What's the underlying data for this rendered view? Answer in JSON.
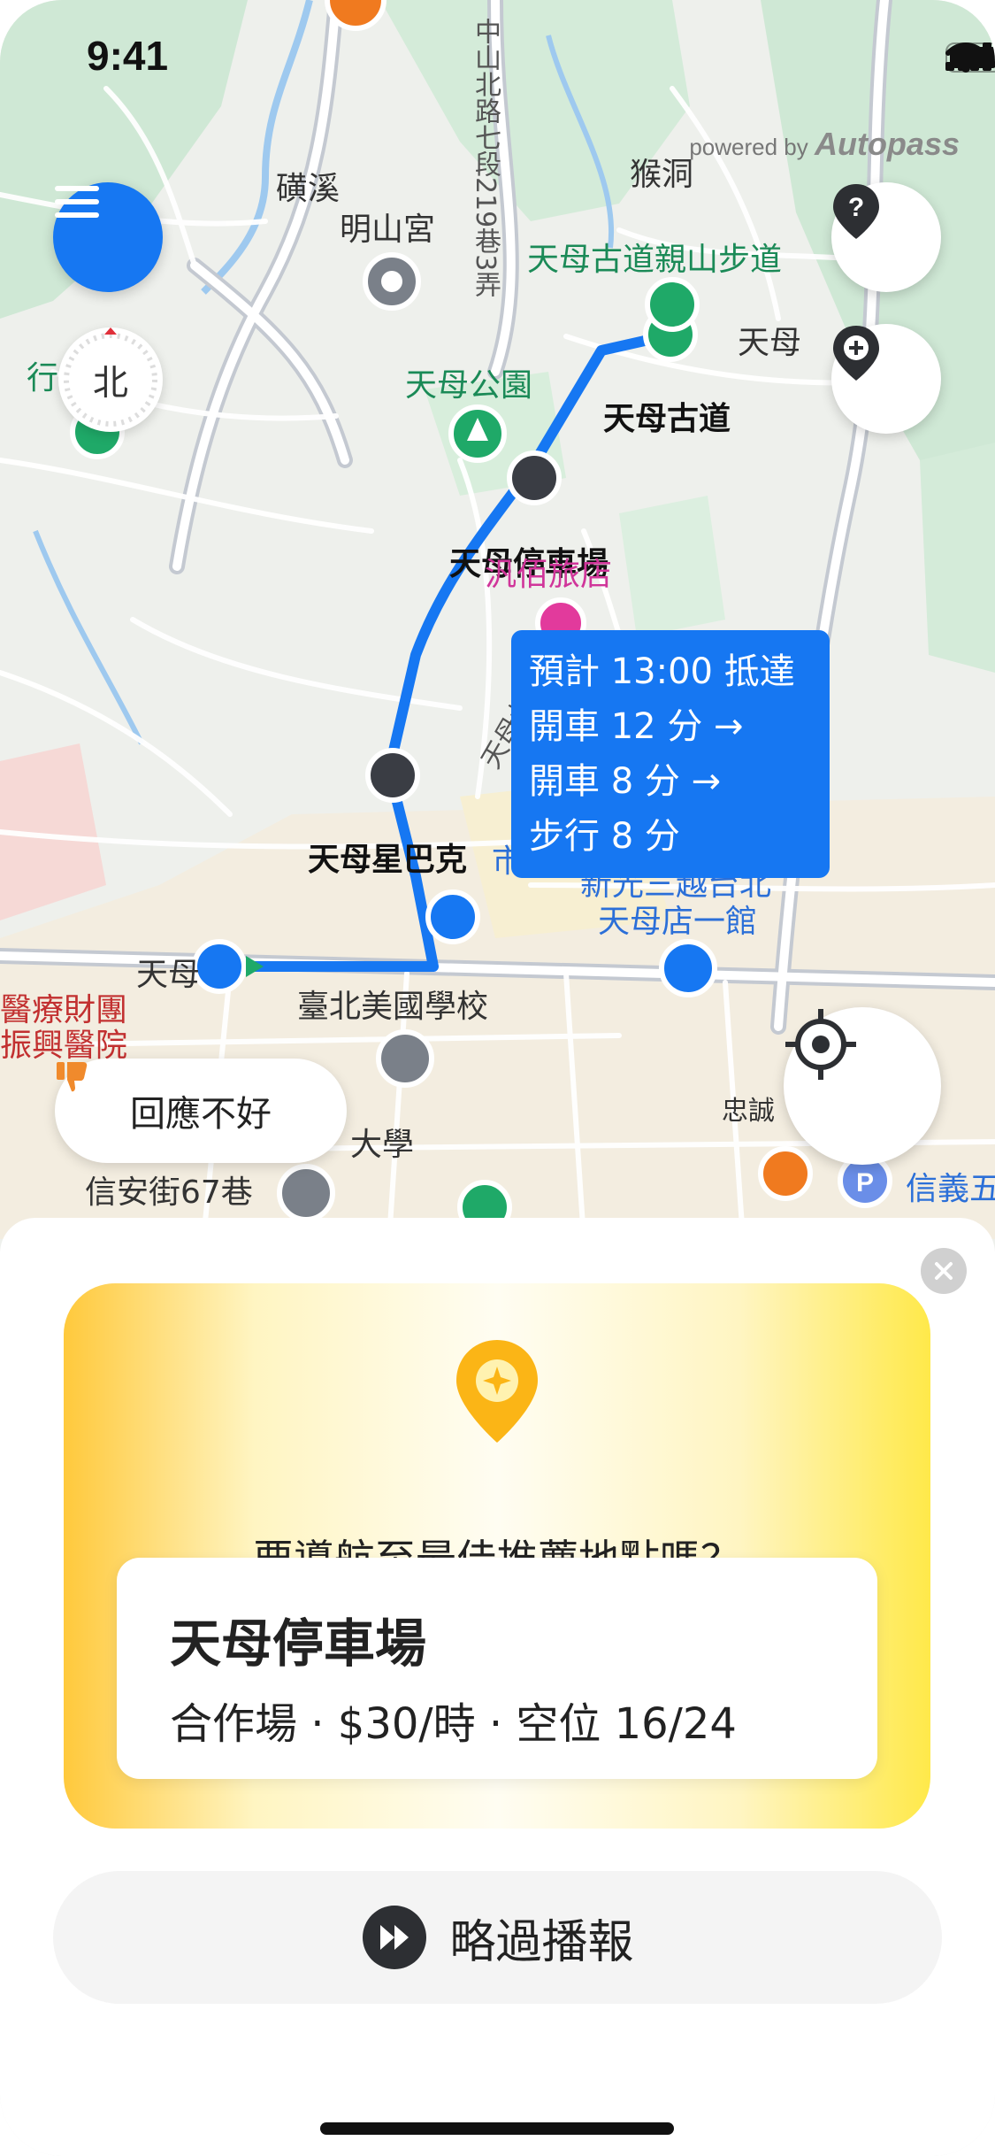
{
  "status": {
    "time": "9:41"
  },
  "map": {
    "attribution_prefix": "powered by",
    "attribution_brand": "Autopass",
    "compass_label": "北",
    "labels": {
      "zhongshan_rd": "中山北路七段219巷3弄",
      "cixi": "磺溪",
      "houdong": "猴洞",
      "mingshan_temple": "明山宮",
      "tianmu_trail": "天母古道親山步道",
      "tianmu_area": "天母",
      "tianmu_park": "天母公園",
      "park_left": "行",
      "hotel": "汎佰旅店",
      "tianmu_west": "天母西路",
      "taipei_american_school": "臺北美國學校",
      "shin_kong_line1": "新光三越台北",
      "shin_kong_line2": "天母店一館",
      "foundation_line1": "醫療財團",
      "foundation_line2": "振興醫院",
      "xinan_lane": "信安街67巷",
      "zhongcheng": "忠誠",
      "xinyi": "信義五",
      "university": "大學",
      "market": "市",
      "street_tian": "天母北路"
    },
    "stops": {
      "destination": "天母古道",
      "parking": "天母停車場",
      "starbucks": "天母星巴克",
      "origin": "天母"
    },
    "eta": {
      "line1": "預計 13:00 抵達",
      "line2": "開車 12 分 →",
      "line3": "開車 8 分 →",
      "line4": "步行 8 分"
    },
    "feedback_label": "回應不好"
  },
  "sheet": {
    "prompt": "要導航至最佳推薦地點嗎？",
    "place_name": "天母停車場",
    "place_detail": "合作場 · $30/時 · 空位 16/24",
    "skip_label": "略過播報"
  },
  "colors": {
    "route_blue": "#1677f2",
    "accent_yellow": "#ffc93c",
    "green_poi": "#1fa968"
  }
}
